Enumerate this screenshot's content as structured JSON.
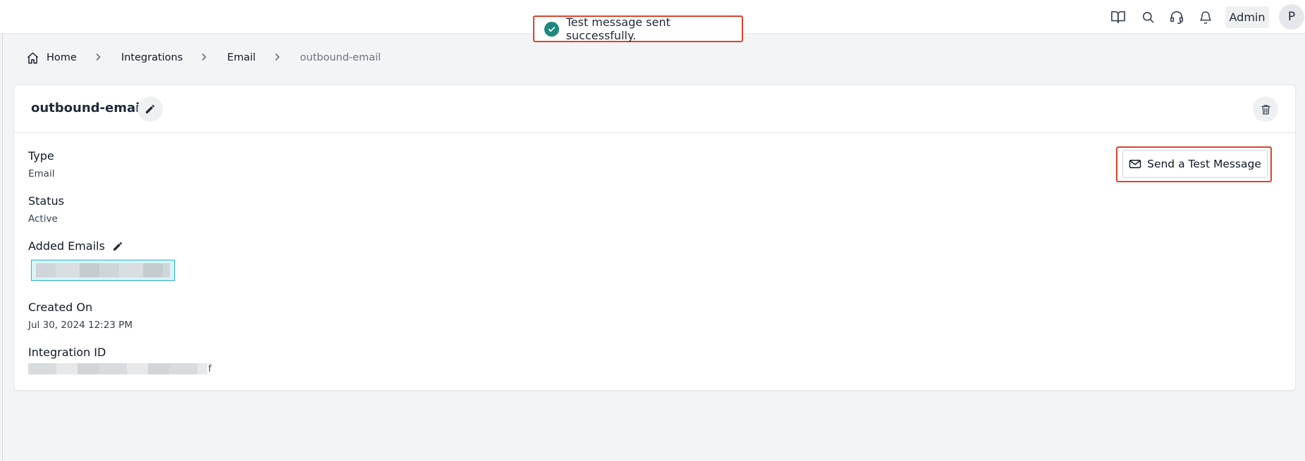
{
  "toast": {
    "message": "Test message sent successfully."
  },
  "topbar": {
    "icons": [
      "book-icon",
      "search-icon",
      "headset-icon",
      "bell-icon"
    ],
    "admin_label": "Admin",
    "avatar_initial": "P"
  },
  "breadcrumb": {
    "items": [
      "Home",
      "Integrations",
      "Email"
    ],
    "current": "outbound-email",
    "separator": ">"
  },
  "card": {
    "title": "outbound-email",
    "send_test_label": "Send a Test Message",
    "fields": {
      "type_label": "Type",
      "type_value": "Email",
      "status_label": "Status",
      "status_value": "Active",
      "emails_label": "Added Emails",
      "created_label": "Created On",
      "created_value": "Jul 30, 2024 12:23 PM",
      "id_label": "Integration ID",
      "id_visible_tail": "f"
    }
  },
  "colors": {
    "accent_success": "#1e8a7d",
    "highlight_outline": "#e0432b",
    "selection": "#27b5c4",
    "background": "#f3f4f6"
  }
}
